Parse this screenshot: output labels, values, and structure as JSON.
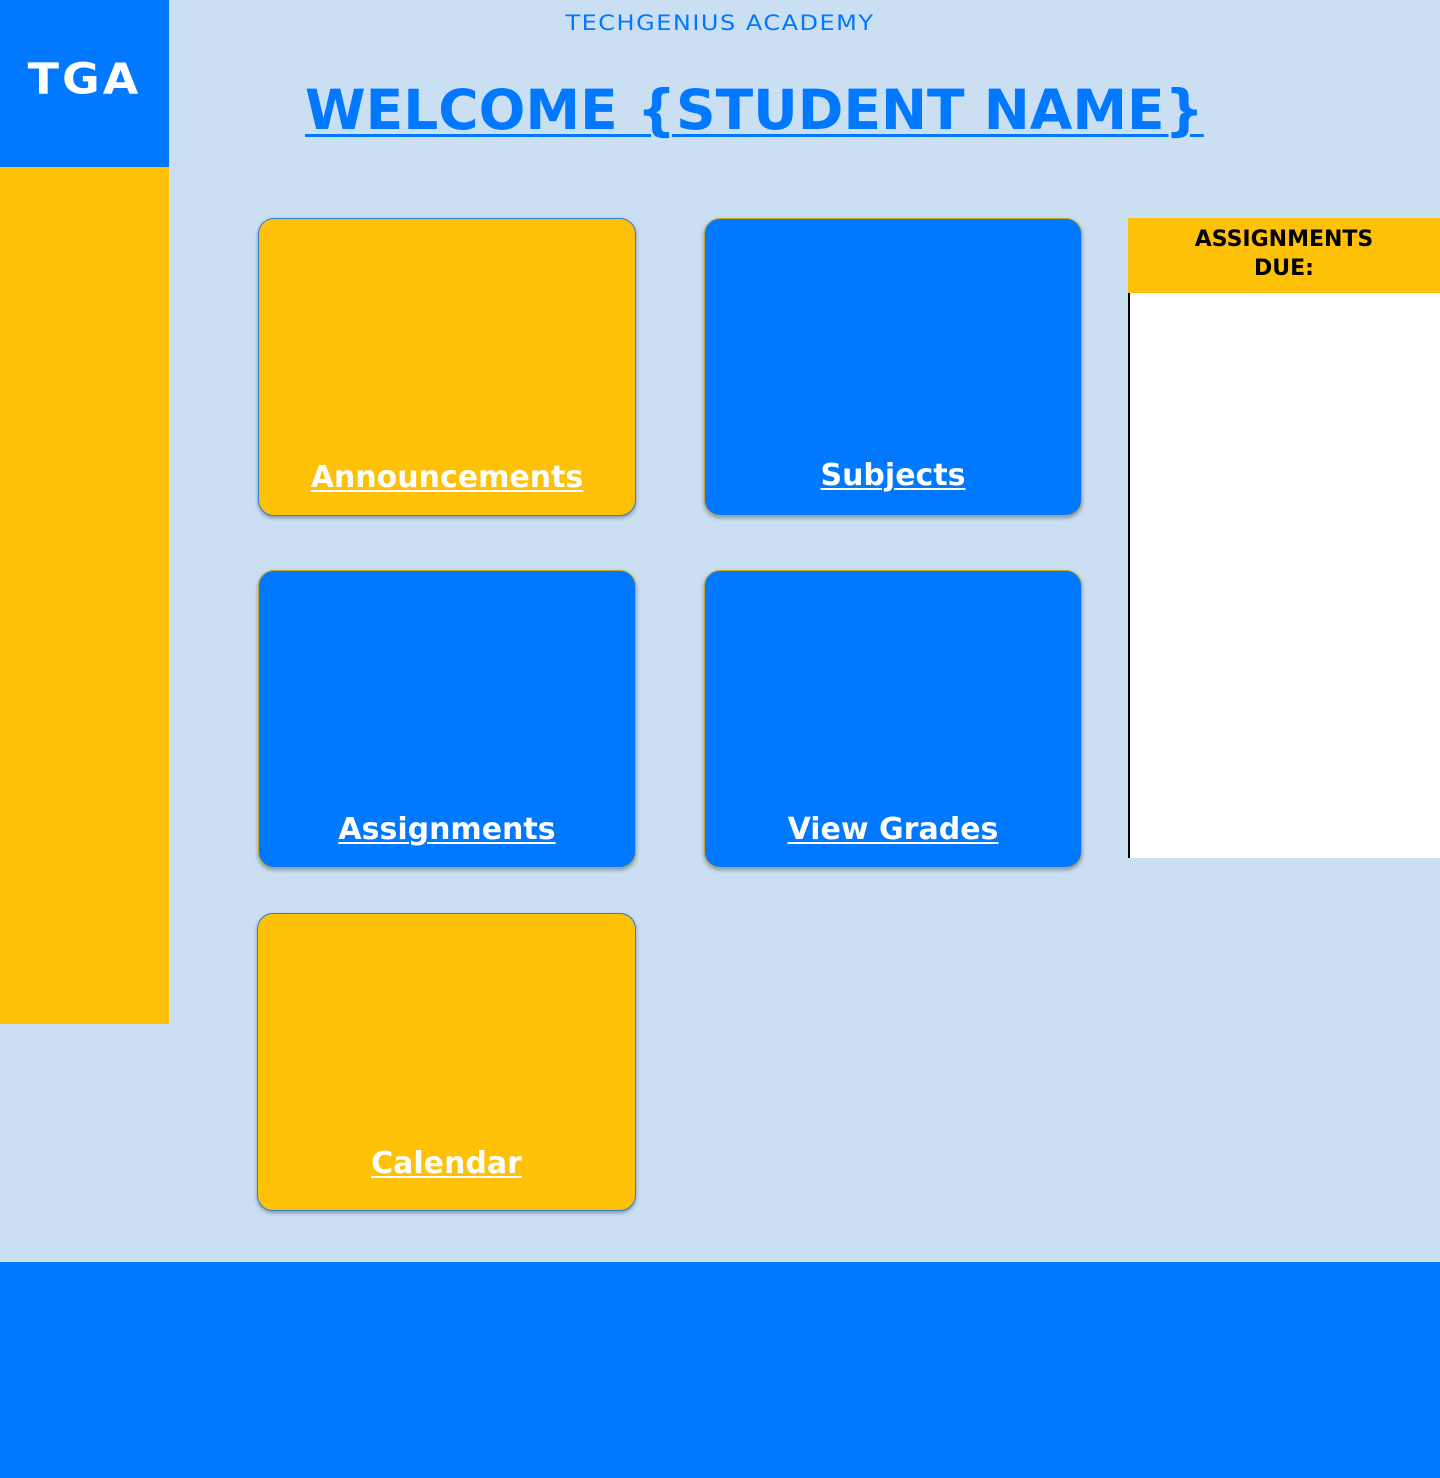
{
  "logo": {
    "text": "TGA"
  },
  "header": {
    "academy_name": "TECHGENIUS ACADEMY",
    "welcome": "WELCOME {STUDENT NAME}"
  },
  "tiles": {
    "announcements": "Announcements",
    "subjects": "Subjects",
    "assignments": "Assignments",
    "view_grades": "View Grades",
    "calendar": "Calendar"
  },
  "assignments_due": {
    "title": "ASSIGNMENTS DUE:",
    "items": []
  },
  "colors": {
    "primary_blue": "#0078FF",
    "accent_yellow": "#FFC107",
    "background": "#CBDFF3",
    "panel_white": "#FFFFFF"
  }
}
